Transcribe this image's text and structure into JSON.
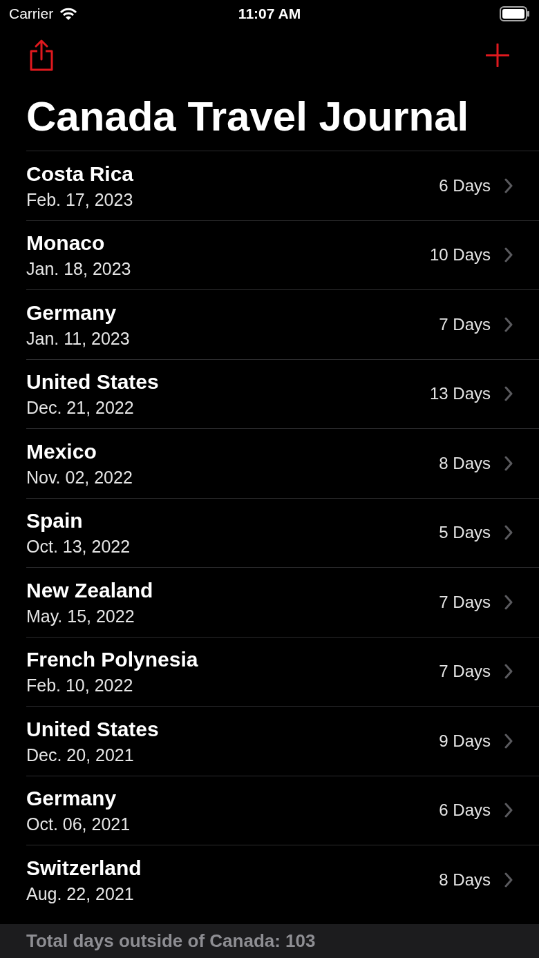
{
  "status_bar": {
    "carrier": "Carrier",
    "time": "11:07 AM"
  },
  "title": "Canada Travel Journal",
  "trips": [
    {
      "country": "Costa Rica",
      "date": "Feb. 17, 2023",
      "duration": "6 Days"
    },
    {
      "country": "Monaco",
      "date": "Jan. 18, 2023",
      "duration": "10 Days"
    },
    {
      "country": "Germany",
      "date": "Jan. 11, 2023",
      "duration": "7 Days"
    },
    {
      "country": "United States",
      "date": "Dec. 21, 2022",
      "duration": "13 Days"
    },
    {
      "country": "Mexico",
      "date": "Nov. 02, 2022",
      "duration": "8 Days"
    },
    {
      "country": "Spain",
      "date": "Oct. 13, 2022",
      "duration": "5 Days"
    },
    {
      "country": "New Zealand",
      "date": "May. 15, 2022",
      "duration": "7 Days"
    },
    {
      "country": "French Polynesia",
      "date": "Feb. 10, 2022",
      "duration": "7 Days"
    },
    {
      "country": "United States",
      "date": "Dec. 20, 2021",
      "duration": "9 Days"
    },
    {
      "country": "Germany",
      "date": "Oct. 06, 2021",
      "duration": "6 Days"
    },
    {
      "country": "Switzerland",
      "date": "Aug. 22, 2021",
      "duration": "8 Days"
    }
  ],
  "footer": "Total days outside of Canada: 103"
}
